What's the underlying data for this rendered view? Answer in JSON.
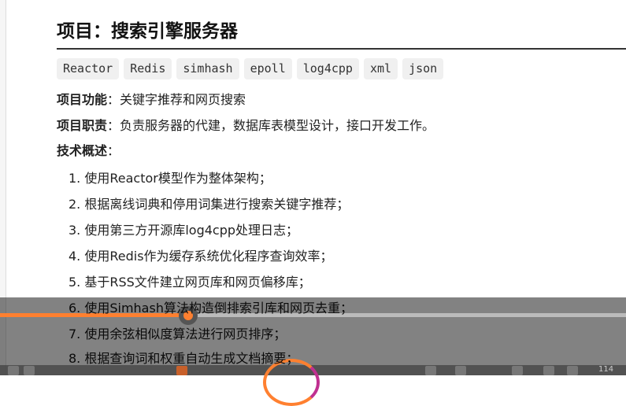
{
  "doc": {
    "title": "项目：搜索引擎服务器",
    "tags": [
      "Reactor",
      "Redis",
      "simhash",
      "epoll",
      "log4cpp",
      "xml",
      "json"
    ],
    "function_label": "项目功能",
    "function_text": "：关键字推荐和网页搜索",
    "duty_label": "项目职责",
    "duty_text": "：负责服务器的代建，数据库表模型设计，接口开发工作。",
    "overview_label": "技术概述",
    "overview_colon": "：",
    "items": [
      "1. 使用Reactor模型作为整体架构；",
      "2. 根据离线词典和停用词集进行搜索关键字推荐；",
      "3. 使用第三方开源库log4cpp处理日志；",
      "4. 使用Redis作为缓存系统优化程序查询效率；",
      "5. 基于RSS文件建立网页库和网页偏移库；",
      "6. 使用Simhash算法构造倒排索引库和网页去重；",
      "7. 使用余弦相似度算法进行网页排序；",
      "8. 根据查询词和权重自动生成文档摘要；"
    ]
  },
  "player": {
    "progress_percent": 30,
    "accent": "#ff8030"
  },
  "taskbar": {
    "zoom_text": "114"
  }
}
